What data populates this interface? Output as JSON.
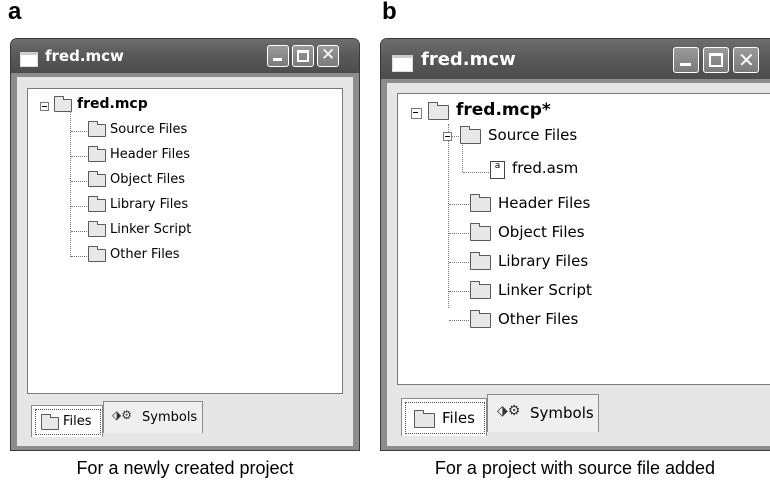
{
  "panel_a": {
    "letter": "a",
    "window_title": "fred.mcw",
    "root": "fred.mcp",
    "folders": [
      "Source Files",
      "Header Files",
      "Object Files",
      "Library Files",
      "Linker Script",
      "Other Files"
    ],
    "tabs": [
      "Files",
      "Symbols"
    ],
    "caption": "For a newly created project"
  },
  "panel_b": {
    "letter": "b",
    "window_title": "fred.mcw",
    "root": "fred.mcp*",
    "source_folder": "Source Files",
    "source_file": "fred.asm",
    "source_file_icon_glyph": "a",
    "other_folders": [
      "Header Files",
      "Object Files",
      "Library Files",
      "Linker Script",
      "Other Files"
    ],
    "tabs": [
      "Files",
      "Symbols"
    ],
    "caption": "For a project with source file added"
  }
}
